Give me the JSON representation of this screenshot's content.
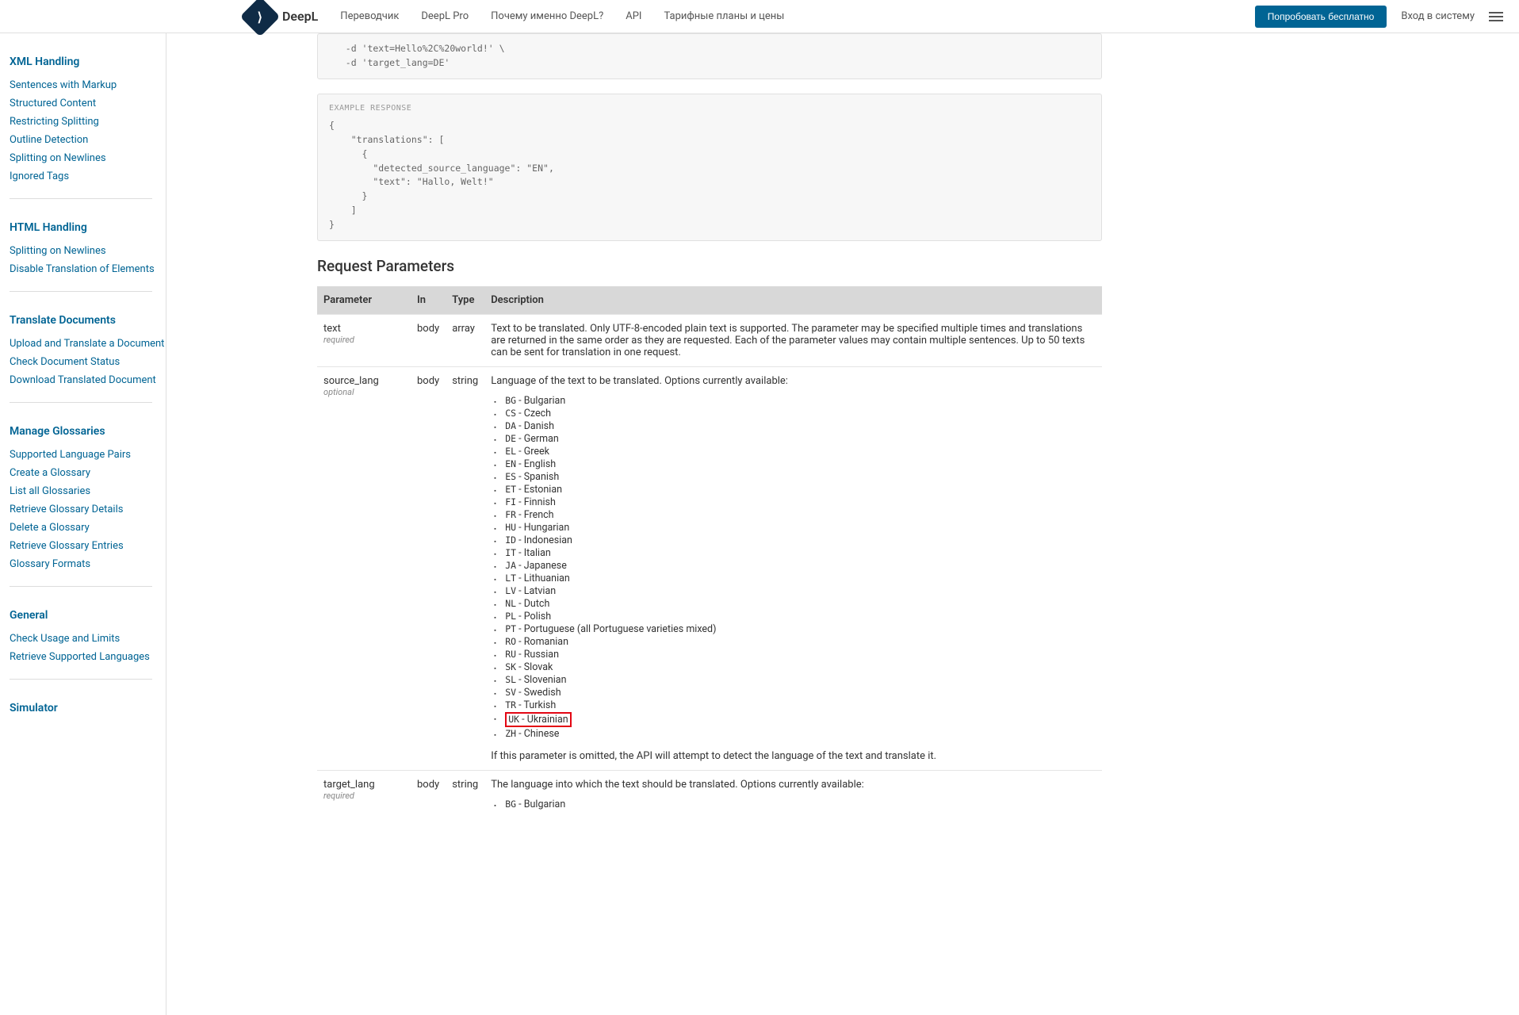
{
  "header": {
    "brand": "DeepL",
    "nav": {
      "translator": "Переводчик",
      "pro": "DeepL Pro",
      "why": "Почему именно DeepL?",
      "api": "API",
      "plans": "Тарифные планы и цены"
    },
    "cta": "Попробовать бесплатно",
    "login": "Вход в систему"
  },
  "sidebar": {
    "s1": {
      "title": "XML Handling",
      "items": [
        "Sentences with Markup",
        "Structured Content",
        "Restricting Splitting",
        "Outline Detection",
        "Splitting on Newlines",
        "Ignored Tags"
      ]
    },
    "s2": {
      "title": "HTML Handling",
      "items": [
        "Splitting on Newlines",
        "Disable Translation of Elements"
      ]
    },
    "s3": {
      "title": "Translate Documents",
      "items": [
        "Upload and Translate a Document",
        "Check Document Status",
        "Download Translated Document"
      ]
    },
    "s4": {
      "title": "Manage Glossaries",
      "items": [
        "Supported Language Pairs",
        "Create a Glossary",
        "List all Glossaries",
        "Retrieve Glossary Details",
        "Delete a Glossary",
        "Retrieve Glossary Entries",
        "Glossary Formats"
      ]
    },
    "s5": {
      "title": "General",
      "items": [
        "Check Usage and Limits",
        "Retrieve Supported Languages"
      ]
    },
    "s6": {
      "title": "Simulator"
    }
  },
  "code": {
    "req_tail": "   -d 'text=Hello%2C%20world!' \\\n   -d 'target_lang=DE'",
    "resp_label": "EXAMPLE RESPONSE",
    "resp": "{\n    \"translations\": [\n      {\n        \"detected_source_language\": \"EN\",\n        \"text\": \"Hallo, Welt!\"\n      }\n    ]\n}"
  },
  "section_title": "Request Parameters",
  "table": {
    "h": {
      "param": "Parameter",
      "in": "In",
      "type": "Type",
      "desc": "Description"
    },
    "r1": {
      "name": "text",
      "req": "required",
      "in": "body",
      "type": "array",
      "desc": "Text to be translated. Only UTF-8-encoded plain text is supported. The parameter may be specified multiple times and translations are returned in the same order as they are requested. Each of the parameter values may contain multiple sentences. Up to 50 texts can be sent for translation in one request."
    },
    "r2": {
      "name": "source_lang",
      "req": "optional",
      "in": "body",
      "type": "string",
      "intro": "Language of the text to be translated. Options currently available:",
      "langs": [
        {
          "c": "BG",
          "n": "Bulgarian"
        },
        {
          "c": "CS",
          "n": "Czech"
        },
        {
          "c": "DA",
          "n": "Danish"
        },
        {
          "c": "DE",
          "n": "German"
        },
        {
          "c": "EL",
          "n": "Greek"
        },
        {
          "c": "EN",
          "n": "English"
        },
        {
          "c": "ES",
          "n": "Spanish"
        },
        {
          "c": "ET",
          "n": "Estonian"
        },
        {
          "c": "FI",
          "n": "Finnish"
        },
        {
          "c": "FR",
          "n": "French"
        },
        {
          "c": "HU",
          "n": "Hungarian"
        },
        {
          "c": "ID",
          "n": "Indonesian"
        },
        {
          "c": "IT",
          "n": "Italian"
        },
        {
          "c": "JA",
          "n": "Japanese"
        },
        {
          "c": "LT",
          "n": "Lithuanian"
        },
        {
          "c": "LV",
          "n": "Latvian"
        },
        {
          "c": "NL",
          "n": "Dutch"
        },
        {
          "c": "PL",
          "n": "Polish"
        },
        {
          "c": "PT",
          "n": "Portuguese (all Portuguese varieties mixed)"
        },
        {
          "c": "RO",
          "n": "Romanian"
        },
        {
          "c": "RU",
          "n": "Russian"
        },
        {
          "c": "SK",
          "n": "Slovak"
        },
        {
          "c": "SL",
          "n": "Slovenian"
        },
        {
          "c": "SV",
          "n": "Swedish"
        },
        {
          "c": "TR",
          "n": "Turkish"
        },
        {
          "c": "UK",
          "n": "Ukrainian",
          "hl": true
        },
        {
          "c": "ZH",
          "n": "Chinese"
        }
      ],
      "outro": "If this parameter is omitted, the API will attempt to detect the language of the text and translate it."
    },
    "r3": {
      "name": "target_lang",
      "req": "required",
      "in": "body",
      "type": "string",
      "intro": "The language into which the text should be translated. Options currently available:",
      "langs": [
        {
          "c": "BG",
          "n": "Bulgarian"
        }
      ]
    }
  }
}
